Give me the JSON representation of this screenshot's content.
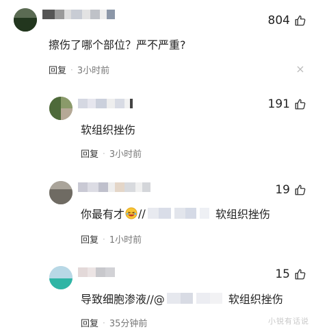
{
  "comments": [
    {
      "likes": "804",
      "text": "擦伤了哪个部位？严不严重?",
      "reply_label": "回复",
      "time": "3小时前"
    },
    {
      "likes": "191",
      "text": "软组织挫伤",
      "reply_label": "回复",
      "time": "3小时前"
    },
    {
      "likes": "19",
      "text_prefix": "你最有才",
      "text_mid": "//",
      "text_suffix": "软组织挫伤",
      "reply_label": "回复",
      "time": "1小时前"
    },
    {
      "likes": "15",
      "text_prefix": "导致细胞渗液//@",
      "text_suffix": "软组织挫伤",
      "reply_label": "回复",
      "time": "35分钟前"
    }
  ],
  "separator": "·",
  "watermark": "小锐有话说",
  "icons": {
    "like": "thumbs-up-icon",
    "close": "close-icon",
    "emoji": "laughing-emoji-icon"
  }
}
